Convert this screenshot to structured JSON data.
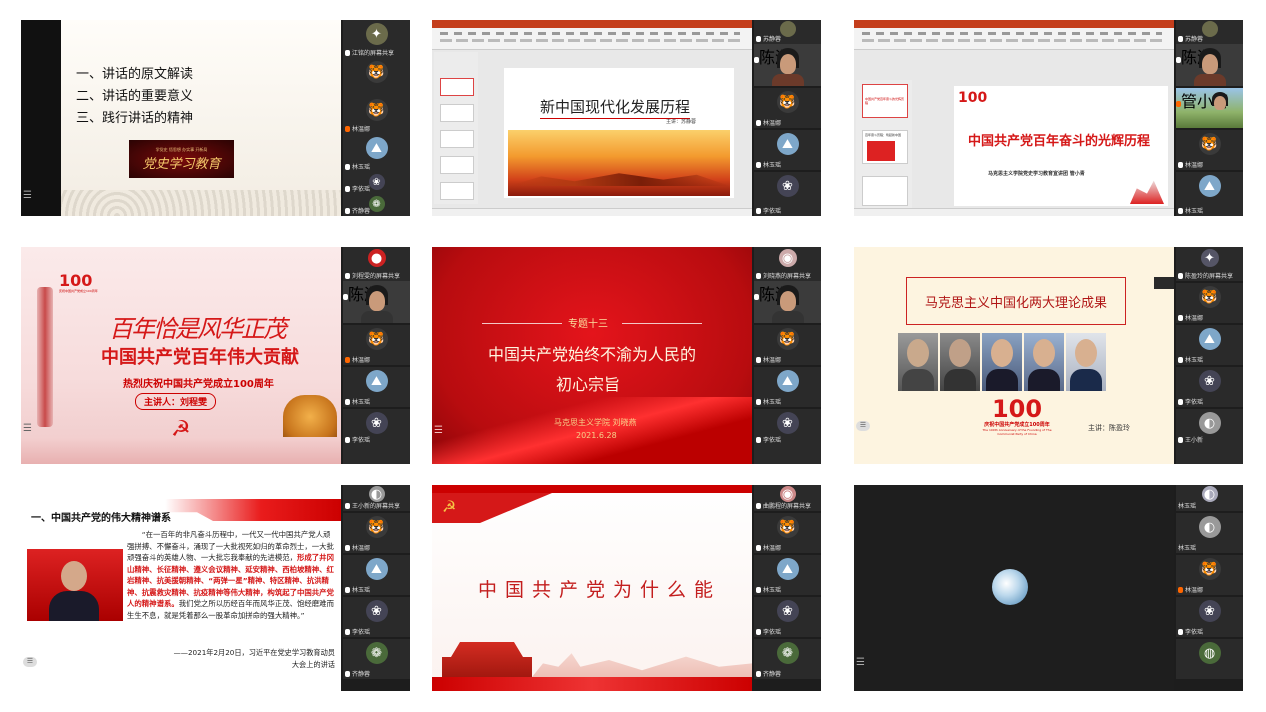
{
  "tiles": [
    {
      "id": "t1",
      "slide": {
        "items": [
          "一、讲话的原文解读",
          "二、讲话的重要意义",
          "三、践行讲话的精神"
        ],
        "banner_text": "党史学习教育",
        "banner_small": "学党史  悟思想  办实事  开新局"
      },
      "gallery": [
        {
          "name": "江铭的屏幕共享",
          "avatar": "✦",
          "kind": "share"
        },
        {
          "name": "",
          "avatar": "🐯",
          "kind": "avatar"
        },
        {
          "name": "林温娜",
          "avatar": "🐯",
          "kind": "avatar",
          "mic": "org"
        },
        {
          "name": "林玉瑶",
          "avatar": "⛰",
          "kind": "avatar"
        },
        {
          "name": "李依瑶",
          "avatar": "❀",
          "kind": "avatar"
        },
        {
          "name": "齐静蓉",
          "avatar": "❁",
          "kind": "avatar"
        }
      ]
    },
    {
      "id": "t2",
      "slide": {
        "title": "新中国现代化发展历程",
        "speaker": "主讲：苏静蓉"
      },
      "gallery": [
        {
          "name": "苏静蓉",
          "avatar": "",
          "kind": "share"
        },
        {
          "name": "陈淑",
          "avatar": "",
          "kind": "camera"
        },
        {
          "name": "林温娜",
          "avatar": "🐯",
          "kind": "avatar"
        },
        {
          "name": "林玉瑶",
          "avatar": "⛰",
          "kind": "avatar"
        },
        {
          "name": "李依瑶",
          "avatar": "❀",
          "kind": "avatar"
        }
      ]
    },
    {
      "id": "t3",
      "slide": {
        "title": "中国共产党百年奋斗的光辉历程",
        "subtitle": "马克思主义学院党史学习教育宣讲团  管小青",
        "thumb1": "中国共产党百年奋斗的光辉历程",
        "thumb2": "百年奋斗历程：筑起新中国"
      },
      "gallery": [
        {
          "name": "苏静蓉",
          "avatar": "",
          "kind": "share"
        },
        {
          "name": "陈淑",
          "avatar": "",
          "kind": "camera"
        },
        {
          "name": "管小青",
          "avatar": "",
          "kind": "landscape"
        },
        {
          "name": "林温娜",
          "avatar": "🐯",
          "kind": "avatar"
        },
        {
          "name": "林玉瑶",
          "avatar": "⛰",
          "kind": "avatar"
        }
      ]
    },
    {
      "id": "t4",
      "slide": {
        "calligraphy": "百年恰是风华正茂",
        "title": "中国共产党百年伟大贡献",
        "subtitle": "热烈庆祝中国共产党成立100周年",
        "speaker": "主讲人：刘程雯",
        "logo_num": "100",
        "logo_small": "庆祝中国共产党成立100周年"
      },
      "gallery": [
        {
          "name": "刘程雯的屏幕共享",
          "avatar": "",
          "kind": "share"
        },
        {
          "name": "陈淑",
          "avatar": "",
          "kind": "camera"
        },
        {
          "name": "林温娜",
          "avatar": "🐯",
          "kind": "avatar",
          "mic": "org"
        },
        {
          "name": "林玉瑶",
          "avatar": "⛰",
          "kind": "avatar"
        },
        {
          "name": "李依瑶",
          "avatar": "❀",
          "kind": "avatar"
        }
      ]
    },
    {
      "id": "t5",
      "slide": {
        "topic": "专题十三",
        "line1": "中国共产党始终不渝为人民的",
        "line2": "初心宗旨",
        "author": "马克思主义学院  刘晓燕",
        "date": "2021.6.28"
      },
      "gallery": [
        {
          "name": "刘晓燕的屏幕共享",
          "avatar": "",
          "kind": "share"
        },
        {
          "name": "陈淑",
          "avatar": "",
          "kind": "camera"
        },
        {
          "name": "林温娜",
          "avatar": "🐯",
          "kind": "avatar"
        },
        {
          "name": "林玉瑶",
          "avatar": "⛰",
          "kind": "avatar"
        },
        {
          "name": "李依瑶",
          "avatar": "❀",
          "kind": "avatar"
        }
      ]
    },
    {
      "id": "t6",
      "slide": {
        "title": "马克思主义中国化两大理论成果",
        "speaker": "主讲：陈盈玲",
        "logo_num": "100",
        "logo_cn": "庆祝中国共产党成立100周年",
        "logo_en": "The 100th Anniversary of the Founding of The Communist Party of China"
      },
      "gallery": [
        {
          "name": "陈盈玲的屏幕共享",
          "avatar": "",
          "kind": "share"
        },
        {
          "name": "林温娜",
          "avatar": "🐯",
          "kind": "avatar"
        },
        {
          "name": "林玉瑶",
          "avatar": "⛰",
          "kind": "avatar"
        },
        {
          "name": "李依瑶",
          "avatar": "❀",
          "kind": "avatar"
        },
        {
          "name": "王小新",
          "avatar": "◐",
          "kind": "avatar"
        }
      ]
    },
    {
      "id": "t7",
      "slide": {
        "heading": "一、中国共产党的伟大精神谱系",
        "quote_a": "“在一百年的非凡奋斗历程中，一代又一代中国共产党人顽强拼搏、不懈奋斗，涌现了一大批视死如归的革命烈士，一大批顽强奋斗的英雄人物、一大批忘我奉献的先进模范，",
        "quote_b": "形成了井冈山精神、长征精神、遵义会议精神、延安精神、西柏坡精神、红岩精神、抗美援朝精神、“两弹一星”精神、特区精神、抗洪精神、抗震救灾精神、抗疫精神等伟大精神，构筑起了中国共产党人的精神谱系。",
        "quote_c": "我们党之所以历经百年而风华正茂、饱经磨难而生生不息，就是凭着那么一股革命加拼命的强大精神。”",
        "source": "——2021年2月20日，习近平在党史学习教育动员大会上的讲话"
      },
      "gallery": [
        {
          "name": "王小新的屏幕共享",
          "avatar": "",
          "kind": "share"
        },
        {
          "name": "林温娜",
          "avatar": "🐯",
          "kind": "avatar"
        },
        {
          "name": "林玉瑶",
          "avatar": "⛰",
          "kind": "avatar"
        },
        {
          "name": "李依瑶",
          "avatar": "❀",
          "kind": "avatar"
        },
        {
          "name": "齐静蓉",
          "avatar": "❁",
          "kind": "avatar"
        }
      ]
    },
    {
      "id": "t8",
      "slide": {
        "title": "中国共产党为什么能"
      },
      "gallery": [
        {
          "name": "曲鹏程的屏幕共享",
          "avatar": "",
          "kind": "share"
        },
        {
          "name": "林温娜",
          "avatar": "🐯",
          "kind": "avatar"
        },
        {
          "name": "林玉瑶",
          "avatar": "⛰",
          "kind": "avatar"
        },
        {
          "name": "李依瑶",
          "avatar": "❀",
          "kind": "avatar"
        },
        {
          "name": "齐静蓉",
          "avatar": "❁",
          "kind": "avatar"
        }
      ]
    },
    {
      "id": "t9",
      "slide": {},
      "gallery": [
        {
          "name": "林玉瑶",
          "avatar": "",
          "kind": "share"
        },
        {
          "name": "林玉瑶",
          "avatar": "◐",
          "kind": "avatar"
        },
        {
          "name": "林温娜",
          "avatar": "🐯",
          "kind": "avatar"
        },
        {
          "name": "李依瑶",
          "avatar": "❀",
          "kind": "avatar"
        },
        {
          "name": "",
          "avatar": "◍",
          "kind": "avatar"
        }
      ]
    }
  ]
}
